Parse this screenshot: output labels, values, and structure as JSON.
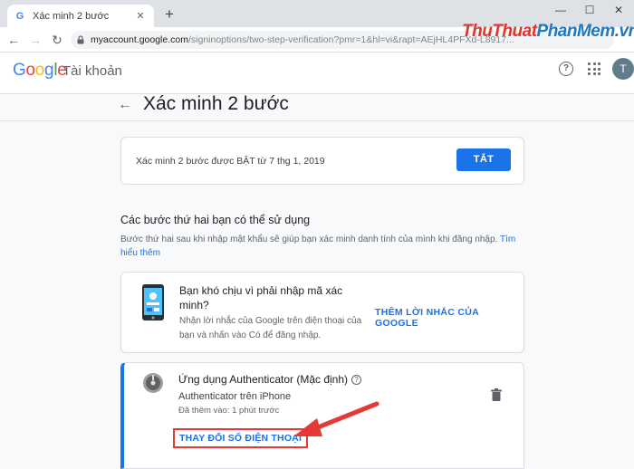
{
  "browser": {
    "tab_title": "Xác minh 2 bước",
    "tab_close": "✕",
    "new_tab": "+",
    "window_controls": [
      "—",
      "☐",
      "✕"
    ],
    "url_host": "myaccount.google.com",
    "url_path": "/signinoptions/two-step-verification?pmr=1&hl=vi&rapt=AEjHL4PFXd-L8917...",
    "watermark_a": "ThuThuat",
    "watermark_b": "PhanMem",
    "watermark_c": ".vn"
  },
  "header": {
    "logo": [
      "G",
      "o",
      "o",
      "g",
      "l",
      "e"
    ],
    "logo_colors": [
      "#4285f4",
      "#ea4335",
      "#fbbc05",
      "#4285f4",
      "#34a853",
      "#ea4335"
    ],
    "account_label": "Tài khoản",
    "help": "?",
    "avatar_letter": "T"
  },
  "page": {
    "back": "←",
    "title": "Xác minh 2 bước"
  },
  "status_card": {
    "text": "Xác minh 2 bước được BẬT từ 7 thg 1, 2019",
    "turn_off_label": "TẮT"
  },
  "second_steps": {
    "title": "Các bước thứ hai bạn có thể sử dụng",
    "description": "Bước thứ hai sau khi nhập mật khẩu sẽ giúp bạn xác minh danh tính của mình khi đăng nhập.",
    "learn_more": "Tìm hiểu thêm"
  },
  "prompt_card": {
    "title": "Bạn khó chịu vì phải nhập mã xác minh?",
    "description": "Nhận lời nhắc của Google trên điện thoại của bạn và nhấn vào Có để đăng nhập.",
    "link": "THÊM LỜI NHẮC CỦA GOOGLE"
  },
  "authenticator_card": {
    "title": "Ứng dụng Authenticator (Mặc định)",
    "help": "?",
    "subtitle": "Authenticator trên iPhone",
    "added": "Đã thêm vào: 1 phút trước",
    "change_phone": "THAY ĐỔI SỐ ĐIỆN THOẠI"
  },
  "colors": {
    "accent": "#1a73e8",
    "highlight": "#e53935"
  }
}
